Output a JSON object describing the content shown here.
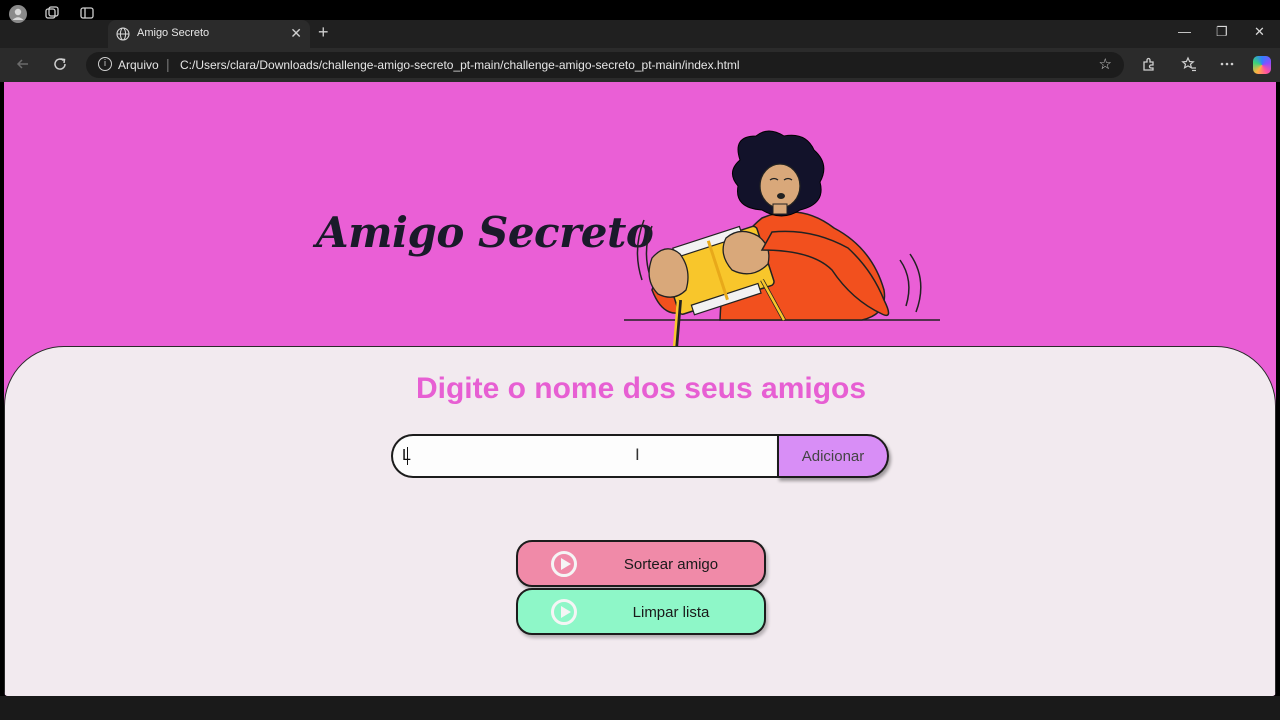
{
  "browser": {
    "tab_title": "Amigo Secreto",
    "tab_close": "✕",
    "new_tab": "+",
    "address_scheme": "Arquivo",
    "address_url": "C:/Users/clara/Downloads/challenge-amigo-secreto_pt-main/challenge-amigo-secreto_pt-main/index.html",
    "window_controls": [
      "—",
      "❐",
      "✕"
    ]
  },
  "page": {
    "hero_title": "Amigo Secreto",
    "section_title": "Digite o nome dos seus amigos",
    "name_input_value": "L",
    "add_button_label": "Adicionar",
    "draw_button_label": "Sortear amigo",
    "clear_button_label": "Limpar lista"
  },
  "colors": {
    "hero_bg": "#ea5fd6",
    "content_bg": "#f2eaef",
    "title_pink": "#e75fd3",
    "add_button": "#d88ef6",
    "draw_button": "#f08aa8",
    "clear_button": "#8ef7c8"
  },
  "icons": [
    "profile-icon",
    "workspaces-icon",
    "tab-actions-icon",
    "globe-icon",
    "back-icon",
    "refresh-icon",
    "info-icon",
    "favorite-star-icon",
    "extensions-icon",
    "favorites-icon",
    "more-icon",
    "copilot-icon",
    "play-icon"
  ]
}
